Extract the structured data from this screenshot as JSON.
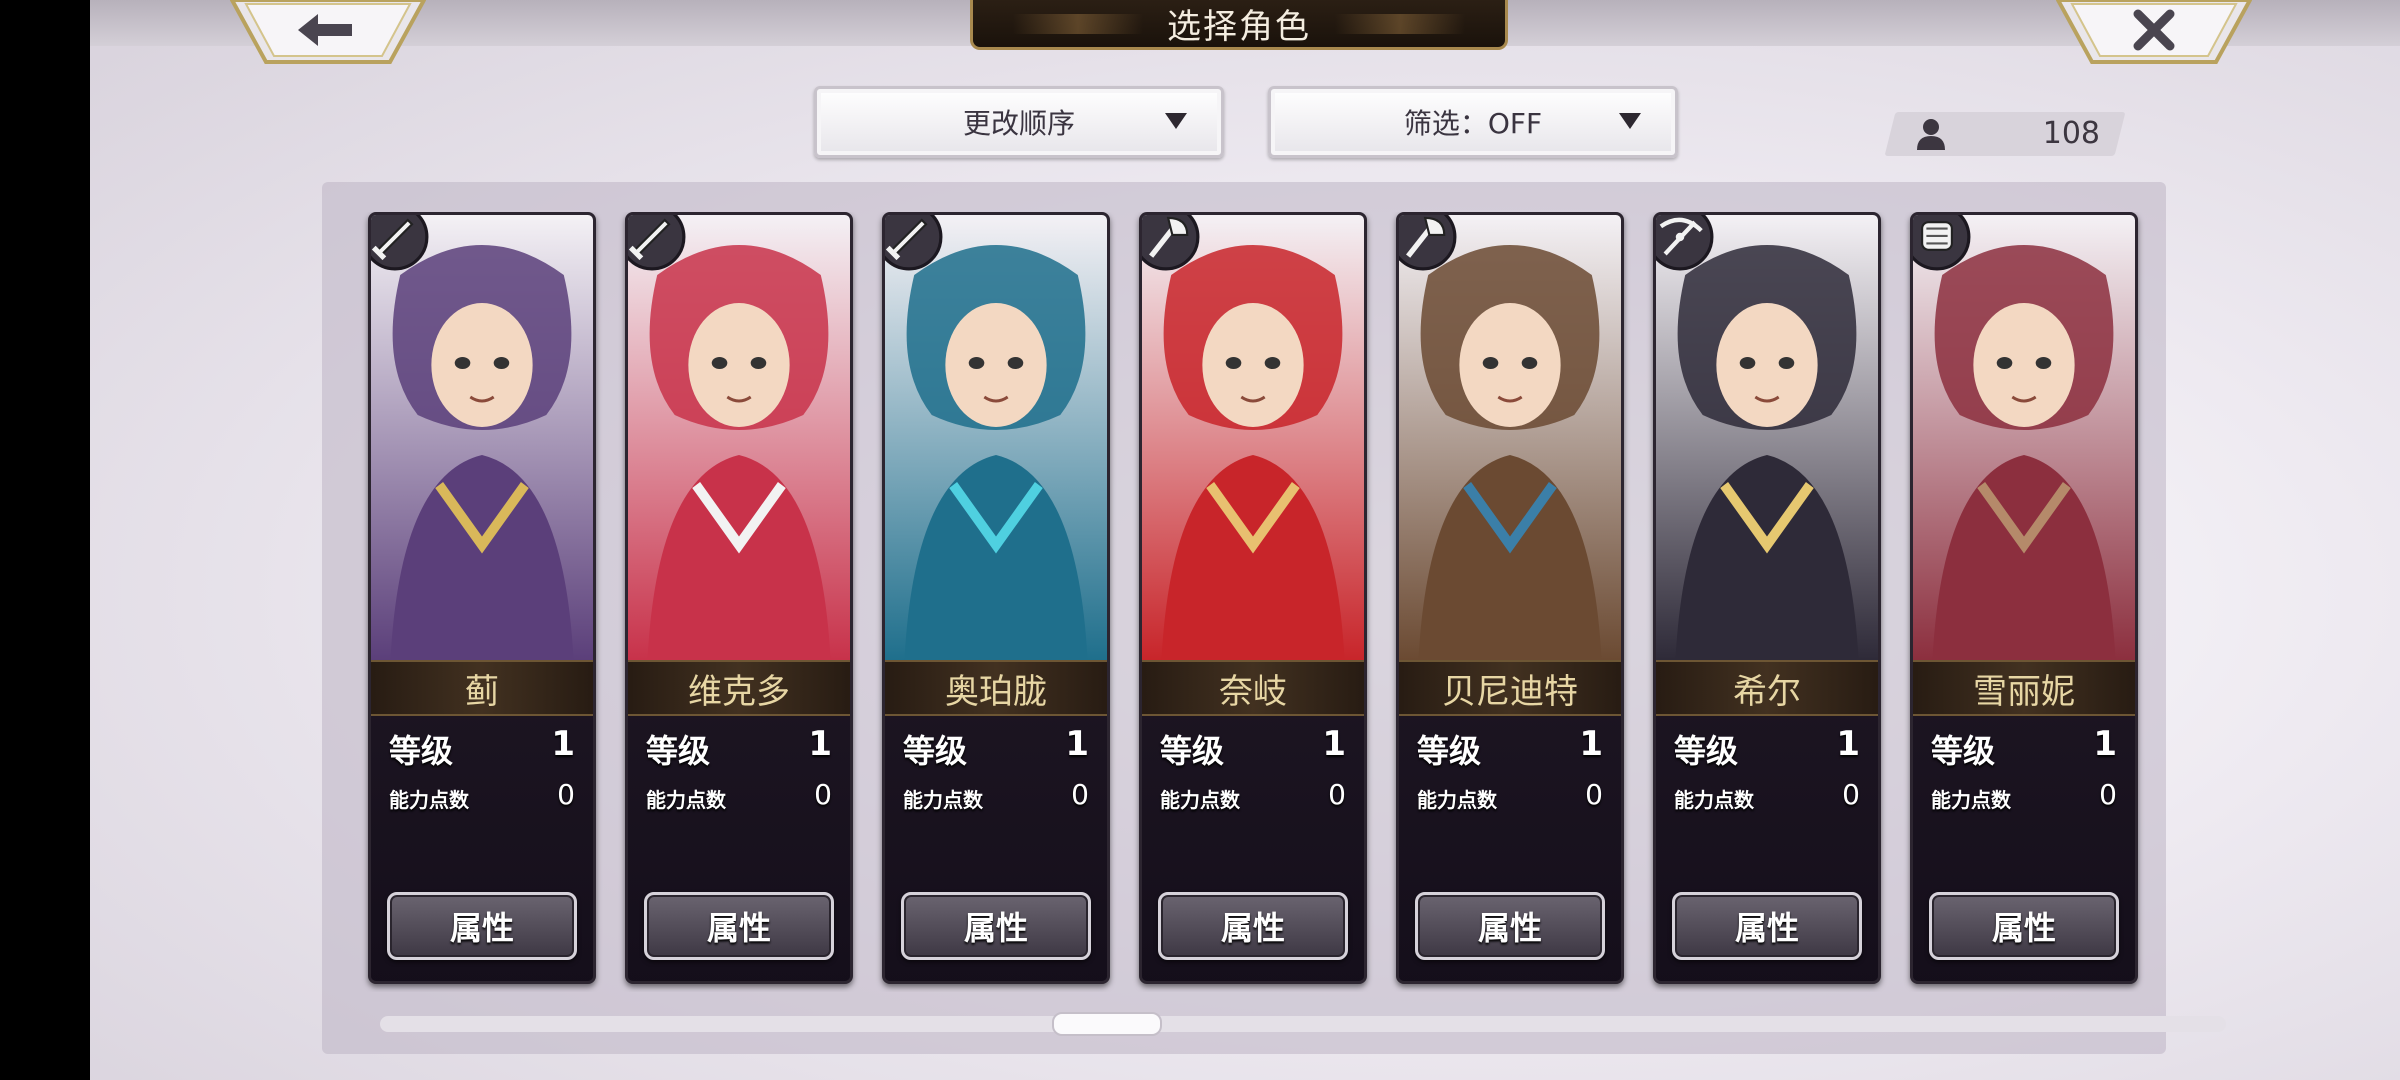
{
  "header": {
    "title": "选择角色"
  },
  "nav": {
    "back_icon": "arrow-left-icon",
    "close_icon": "close-x-icon"
  },
  "toolbar": {
    "sort_label": "更改顺序",
    "filter_label": "筛选：OFF",
    "count": "108",
    "count_icon": "person-icon"
  },
  "labels": {
    "level": "等级",
    "ability_points": "能力点数",
    "attributes_button": "属性"
  },
  "characters": [
    {
      "name": "蓟",
      "level": "1",
      "points": "0",
      "weapon": "sword-icon",
      "color": "#5b3f7a",
      "accent": "#d9b85a"
    },
    {
      "name": "维克多",
      "level": "1",
      "points": "0",
      "weapon": "sword-icon",
      "color": "#c8324a",
      "accent": "#f2f2f2"
    },
    {
      "name": "奥珀胧",
      "level": "1",
      "points": "0",
      "weapon": "sword-icon",
      "color": "#1f6f8c",
      "accent": "#4fd0e0"
    },
    {
      "name": "奈岐",
      "level": "1",
      "points": "0",
      "weapon": "axe-icon",
      "color": "#c8252a",
      "accent": "#e8c070"
    },
    {
      "name": "贝尼迪特",
      "level": "1",
      "points": "0",
      "weapon": "axe-icon",
      "color": "#6b4a32",
      "accent": "#3b7fa8"
    },
    {
      "name": "希尔",
      "level": "1",
      "points": "0",
      "weapon": "crossbow-icon",
      "color": "#2e2a38",
      "accent": "#e6c870"
    },
    {
      "name": "雪丽妮",
      "level": "1",
      "points": "0",
      "weapon": "fist-icon",
      "color": "#8c2f3e",
      "accent": "#b58a6a"
    }
  ],
  "colors": {
    "accent_gold": "#a8894e",
    "name_text": "#e7d6a4"
  }
}
